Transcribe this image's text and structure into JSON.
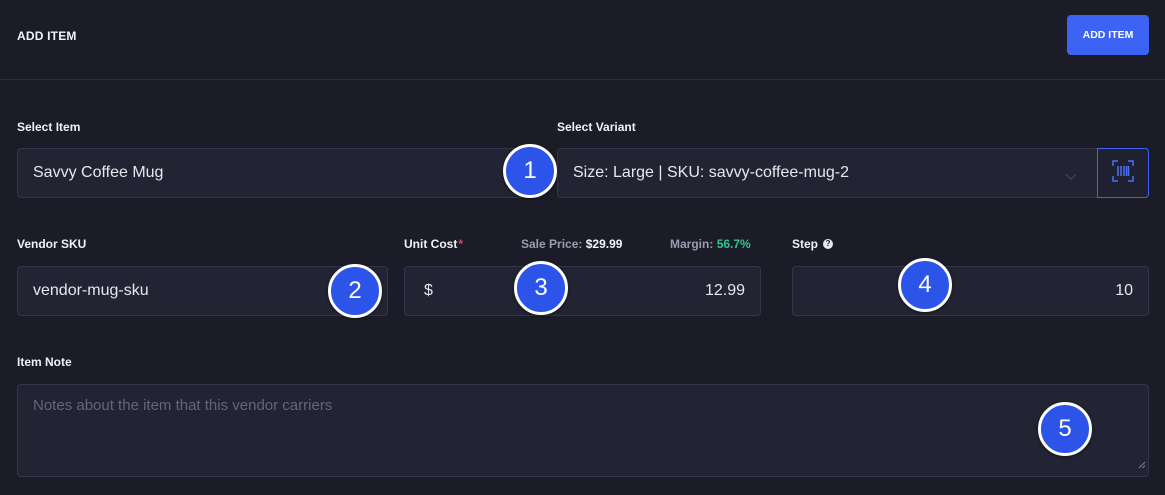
{
  "header": {
    "title": "ADD ITEM",
    "add_button_label": "ADD ITEM"
  },
  "form": {
    "select_item": {
      "label": "Select Item",
      "value": "Savvy Coffee Mug"
    },
    "select_variant": {
      "label": "Select Variant",
      "value": "Size: Large | SKU: savvy-coffee-mug-2"
    },
    "vendor_sku": {
      "label": "Vendor SKU",
      "value": "vendor-mug-sku"
    },
    "unit_cost": {
      "label": "Unit Cost",
      "required_marker": "*",
      "currency_symbol": "$",
      "value": "12.99",
      "sale_price_label": "Sale Price:",
      "sale_price_value": "$29.99",
      "margin_label": "Margin:",
      "margin_value": "56.7%"
    },
    "step": {
      "label": "Step",
      "help_glyph": "?",
      "value": "10"
    },
    "item_note": {
      "label": "Item Note",
      "placeholder": "Notes about the item that this vendor carriers"
    }
  },
  "annotations": [
    "1",
    "2",
    "3",
    "4",
    "5"
  ],
  "colors": {
    "accent": "#3d63f4",
    "margin_green": "#2fc58f",
    "required_red": "#e4475a",
    "background": "#1b1c28"
  },
  "icons": {
    "variant_dropdown": "chevron-down-icon",
    "scan_button": "barcode-scan-icon",
    "step_help": "help-icon",
    "note_resize": "resize-handle-icon"
  }
}
